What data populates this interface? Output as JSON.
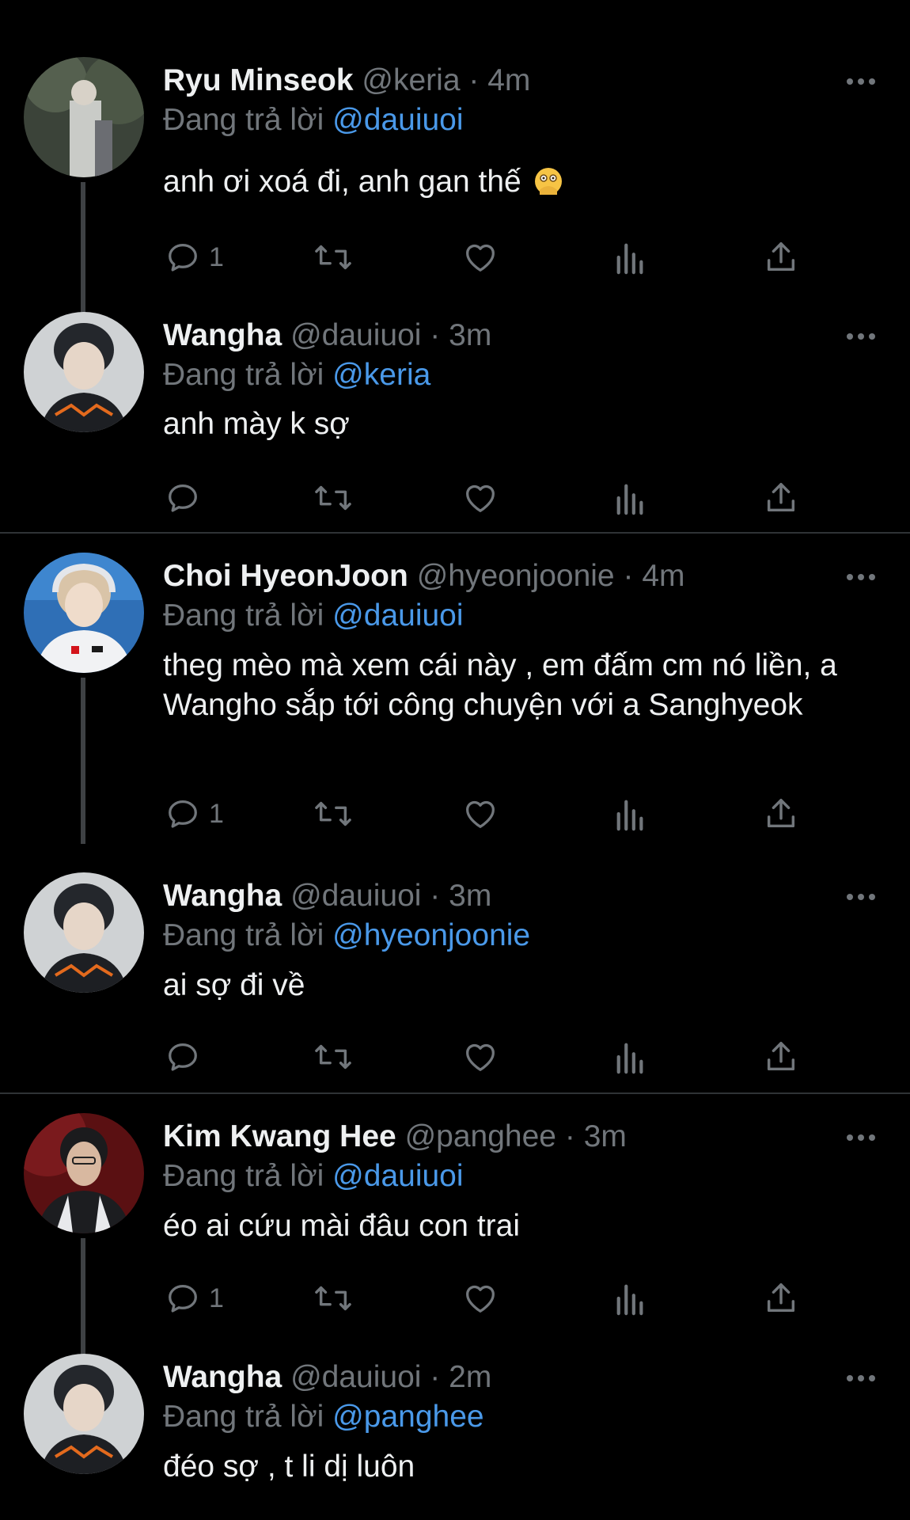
{
  "reply_prefix": "Đang trả lời",
  "tweets": [
    {
      "name": "Ryu Minseok",
      "handle": "@keria",
      "dot": "·",
      "time": "4m",
      "reply_to": "@dauiuoi",
      "text": "anh ơi xoá đi, anh gan thế",
      "emoji": "face-with-open-eyes-and-hand-over-mouth",
      "reply_count": "1"
    },
    {
      "name": "Wangha",
      "handle": "@dauiuoi",
      "dot": "·",
      "time": "3m",
      "reply_to": "@keria",
      "text": "anh mày k sợ",
      "reply_count": ""
    },
    {
      "name": "Choi HyeonJoon",
      "handle": "@hyeonjoonie",
      "dot": "·",
      "time": "4m",
      "reply_to": "@dauiuoi",
      "text": "theg mèo mà xem cái này , em đấm cm nó liền, a Wangho sắp tới công chuyện với a Sanghyeok",
      "reply_count": "1"
    },
    {
      "name": "Wangha",
      "handle": "@dauiuoi",
      "dot": "·",
      "time": "3m",
      "reply_to": "@hyeonjoonie",
      "text": "ai sợ đi về",
      "reply_count": ""
    },
    {
      "name": "Kim Kwang Hee",
      "handle": "@panghee",
      "dot": "·",
      "time": "3m",
      "reply_to": "@dauiuoi",
      "text": "éo ai cứu mài đâu con trai",
      "reply_count": "1"
    },
    {
      "name": "Wangha",
      "handle": "@dauiuoi",
      "dot": "·",
      "time": "2m",
      "reply_to": "@panghee",
      "text": "đéo sợ , t li dị luôn",
      "reply_count": ""
    }
  ],
  "icons": {
    "reply": "reply-icon",
    "retweet": "retweet-icon",
    "like": "heart-icon",
    "views": "views-icon",
    "share": "share-icon",
    "more": "more-icon"
  },
  "colors": {
    "background": "#000000",
    "text": "#eef0f1",
    "muted": "#71767b",
    "mention": "#4a99e9",
    "divider": "#2f3336"
  }
}
